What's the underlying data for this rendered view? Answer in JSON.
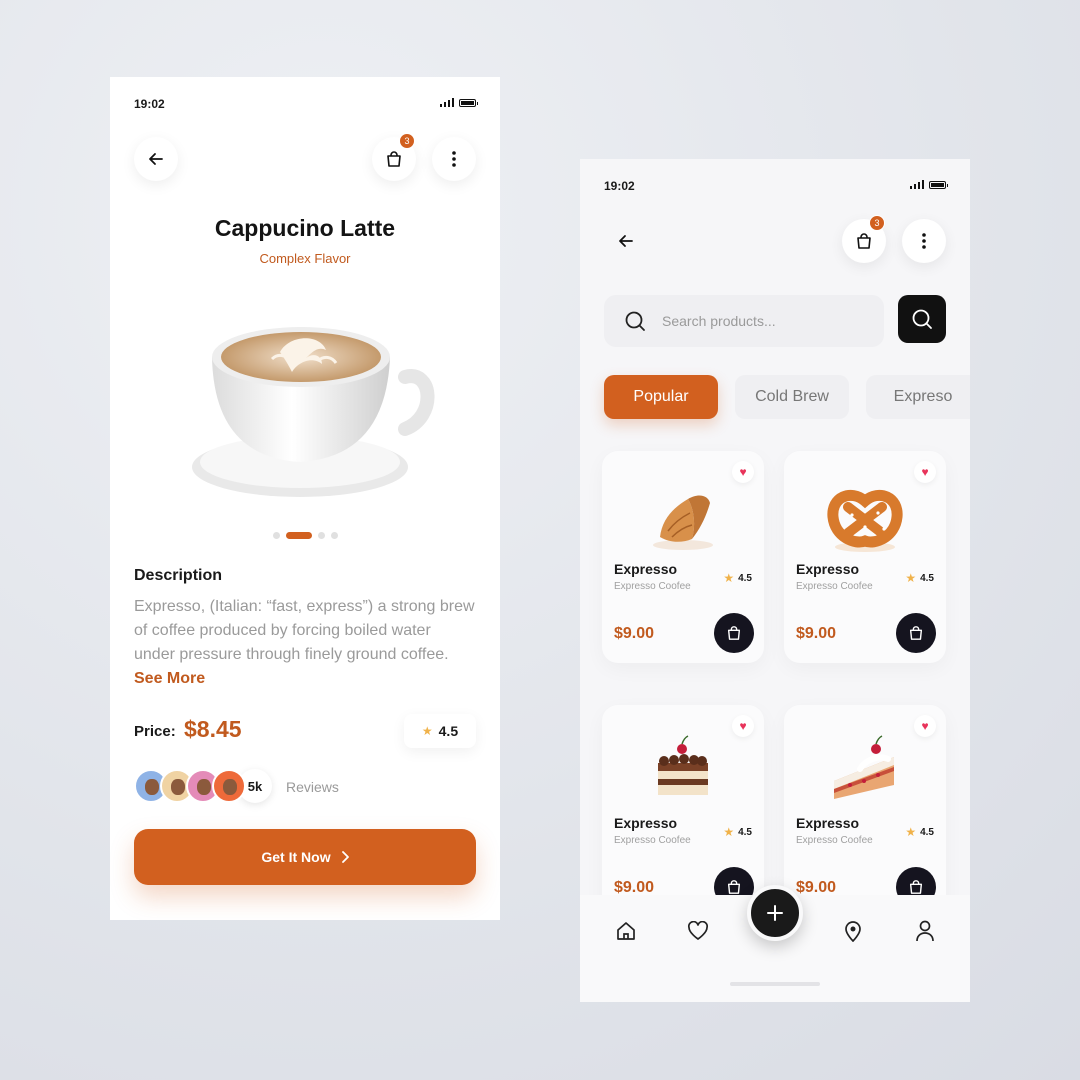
{
  "detail_screen": {
    "status_time": "19:02",
    "cart_count": "3",
    "title": "Cappucino Latte",
    "subtitle": "Complex Flavor",
    "description_heading": "Description",
    "description_text": "Expresso, (Italian: “fast, express”) a strong brew of coffee produced by forcing boiled water under pressure through finely ground coffee.",
    "see_more": "See More",
    "price_label": "Price:",
    "price_value": "$8.45",
    "rating": "4.5",
    "review_count": "5k",
    "reviews_label": "Reviews",
    "cta_label": "Get It Now",
    "carousel": {
      "total": 4,
      "active_index": 1
    }
  },
  "list_screen": {
    "status_time": "19:02",
    "cart_count": "3",
    "search_placeholder": "Search products...",
    "tabs": [
      {
        "label": "Popular",
        "active": true
      },
      {
        "label": "Cold Brew",
        "active": false
      },
      {
        "label": "Expreso",
        "active": false
      }
    ],
    "products": [
      {
        "name": "Expresso",
        "sub": "Expresso Coofee",
        "rating": "4.5",
        "price": "$9.00",
        "image": "croissant",
        "favorited": true
      },
      {
        "name": "Expresso",
        "sub": "Expresso Coofee",
        "rating": "4.5",
        "price": "$9.00",
        "image": "pretzel",
        "favorited": true
      },
      {
        "name": "Expresso",
        "sub": "Expresso Coofee",
        "rating": "4.5",
        "price": "$9.00",
        "image": "chocolate-cake-slice",
        "favorited": true
      },
      {
        "name": "Expresso",
        "sub": "Expresso Coofee",
        "rating": "4.5",
        "price": "$9.00",
        "image": "cherry-cake-slice",
        "favorited": true
      }
    ],
    "nav_items": [
      "home-icon",
      "heart-icon",
      "add-icon",
      "location-pin-icon",
      "profile-icon"
    ]
  },
  "colors": {
    "accent": "#d2601f",
    "dark": "#15141f",
    "heart": "#e8335a",
    "star": "#f0b24a"
  }
}
